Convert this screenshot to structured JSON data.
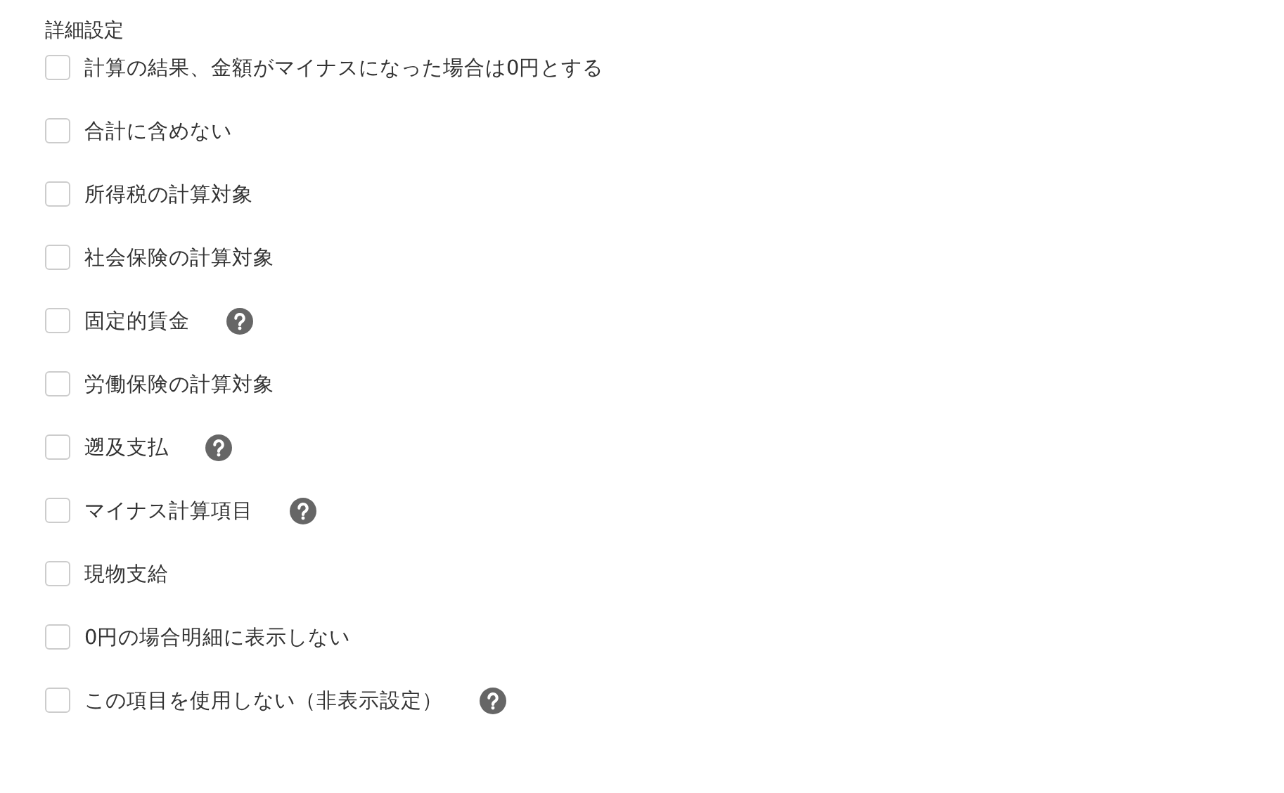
{
  "section_title": "詳細設定",
  "options": [
    {
      "label": "計算の結果、金額がマイナスになった場合は0円とする",
      "checked": false,
      "help": false
    },
    {
      "label": "合計に含めない",
      "checked": false,
      "help": false
    },
    {
      "label": "所得税の計算対象",
      "checked": false,
      "help": false
    },
    {
      "label": "社会保険の計算対象",
      "checked": false,
      "help": false
    },
    {
      "label": "固定的賃金",
      "checked": false,
      "help": true
    },
    {
      "label": "労働保険の計算対象",
      "checked": false,
      "help": false
    },
    {
      "label": "遡及支払",
      "checked": false,
      "help": true
    },
    {
      "label": "マイナス計算項目",
      "checked": false,
      "help": true
    },
    {
      "label": "現物支給",
      "checked": false,
      "help": false
    },
    {
      "label": "0円の場合明細に表示しない",
      "checked": false,
      "help": false
    },
    {
      "label": "この項目を使用しない（非表示設定）",
      "checked": false,
      "help": true
    }
  ]
}
